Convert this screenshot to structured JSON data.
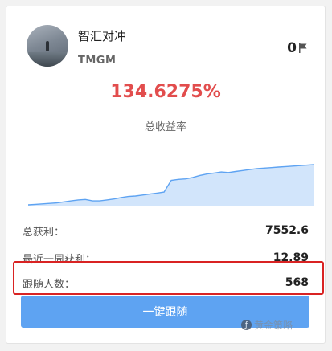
{
  "trader": {
    "name": "智汇对冲",
    "broker": "TMGM",
    "flag_count": "0"
  },
  "performance": {
    "total_return": "134.6275%",
    "total_return_label": "总收益率"
  },
  "chart_data": {
    "type": "area",
    "x": [
      0,
      1,
      2,
      3,
      4,
      5,
      6,
      7,
      8,
      9,
      10,
      11,
      12,
      13,
      14,
      15,
      16,
      17,
      18,
      19,
      20,
      21,
      22,
      23,
      24,
      25,
      26,
      27,
      28,
      29,
      30,
      31,
      32,
      33,
      34,
      35,
      36,
      37,
      38,
      39,
      40
    ],
    "values": [
      0,
      0.5,
      1,
      1.5,
      2,
      3,
      4,
      5,
      5.5,
      4,
      4,
      5,
      6,
      7.5,
      8.5,
      9,
      10,
      11,
      12,
      13,
      25,
      26,
      26.5,
      28,
      30,
      31.5,
      32.5,
      33.5,
      33,
      34,
      35,
      36,
      37,
      37.5,
      38,
      38.5,
      39,
      39.5,
      40,
      40.5,
      41
    ],
    "color": "#5ea3f2"
  },
  "stats": [
    {
      "label": "总获利：",
      "value": "7552.6"
    },
    {
      "label": "最近一周获利：",
      "value": "12.89"
    },
    {
      "label": "跟随人数：",
      "value": "568"
    }
  ],
  "actions": {
    "follow_label": "一键跟随"
  },
  "watermark": {
    "text": "黄金策略"
  },
  "colors": {
    "accent": "#5ea3f2",
    "return": "#e24d4d",
    "highlight": "#d92323"
  }
}
